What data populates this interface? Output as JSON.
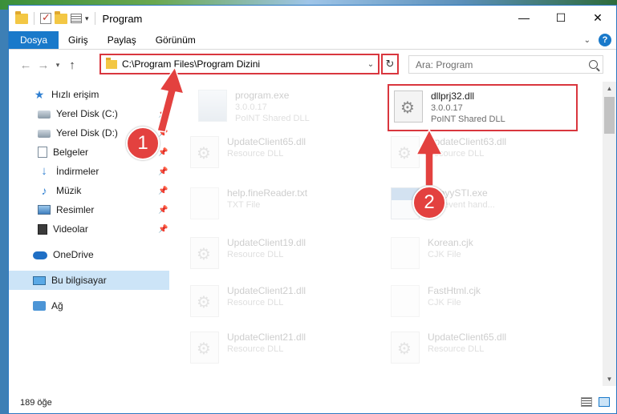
{
  "window": {
    "title": "Program",
    "controls": {
      "minimize": "—",
      "maximize": "☐",
      "close": "✕"
    }
  },
  "ribbon": {
    "tabs": [
      {
        "label": "Dosya",
        "active": true
      },
      {
        "label": "Giriş"
      },
      {
        "label": "Paylaş"
      },
      {
        "label": "Görünüm"
      }
    ],
    "help": "?"
  },
  "address": {
    "path": "C:\\Program Files\\Program Dizini",
    "search_placeholder": "Ara: Program"
  },
  "sidebar": {
    "items": [
      {
        "label": "Hızlı erişim",
        "icon": "star-icon"
      },
      {
        "label": "Yerel Disk (C:)",
        "icon": "drive-icon"
      },
      {
        "label": "Yerel Disk (D:)",
        "icon": "drive-icon"
      },
      {
        "label": "Belgeler",
        "icon": "documents-icon"
      },
      {
        "label": "İndirmeler",
        "icon": "downloads-icon"
      },
      {
        "label": "Müzik",
        "icon": "music-icon"
      },
      {
        "label": "Resimler",
        "icon": "pictures-icon"
      },
      {
        "label": "Videolar",
        "icon": "videos-icon"
      },
      {
        "label": "OneDrive",
        "icon": "onedrive-icon"
      },
      {
        "label": "Bu bilgisayar",
        "icon": "this-pc-icon"
      },
      {
        "label": "Ağ",
        "icon": "network-icon"
      }
    ]
  },
  "files": [
    {
      "name": "program.exe",
      "line1": "3.0.0.17",
      "line2": "PoINT Shared DLL"
    },
    {
      "name": "UpdateClient65.dll",
      "line1": "Resource DLL"
    },
    {
      "name": "UpdateClient63.dll",
      "line1": "Resource DLL"
    },
    {
      "name": "help.fineReader.txt",
      "line1": "TXT File"
    },
    {
      "name": "AbbyySTI.exe",
      "line1": "STI event hand..."
    },
    {
      "name": "UpdateClient19.dll",
      "line1": "Resource DLL"
    },
    {
      "name": "Korean.cjk",
      "line1": "CJK File"
    },
    {
      "name": "UpdateClient21.dll",
      "line1": "Resource DLL"
    },
    {
      "name": "FastHtml.cjk",
      "line1": "CJK File"
    },
    {
      "name": "UpdateClient21.dll",
      "line1": "Resource DLL"
    },
    {
      "name": "UpdateClient65.dll",
      "line1": "Resource DLL"
    }
  ],
  "highlighted_file": {
    "name": "dllprj32.dll",
    "line1": "3.0.0.17",
    "line2": "PoINT Shared DLL"
  },
  "status": {
    "count": "189 öğe"
  },
  "annotations": {
    "step1": "1",
    "step2": "2",
    "color": "#e3413f"
  }
}
